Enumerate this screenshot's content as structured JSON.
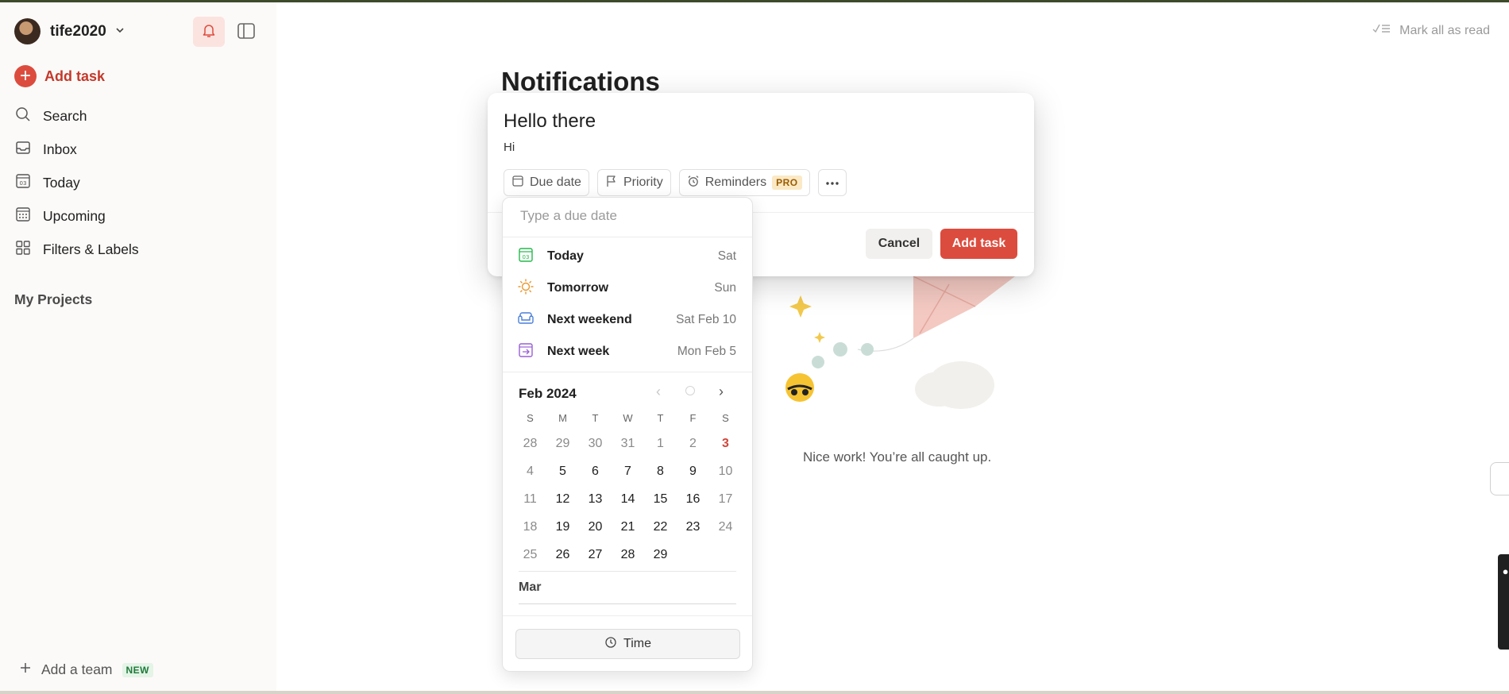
{
  "sidebar": {
    "username": "tife2020",
    "add_task": "Add task",
    "nav": [
      {
        "label": "Search",
        "icon": "search-icon"
      },
      {
        "label": "Inbox",
        "icon": "inbox-icon"
      },
      {
        "label": "Today",
        "icon": "calendar-today-icon"
      },
      {
        "label": "Upcoming",
        "icon": "calendar-grid-icon"
      },
      {
        "label": "Filters & Labels",
        "icon": "filters-icon"
      }
    ],
    "my_projects": "My Projects",
    "add_team": "Add a team",
    "new_badge": "NEW"
  },
  "main": {
    "mark_all_read": "Mark all as read",
    "title": "Notifications",
    "empty_message": "Nice work! You’re all caught up."
  },
  "task_modal": {
    "title": "Hello there",
    "description": "Hi",
    "chips": {
      "due_date": "Due date",
      "priority": "Priority",
      "reminders": "Reminders",
      "pro_badge": "PRO"
    },
    "cancel": "Cancel",
    "add_task": "Add task"
  },
  "due_date_picker": {
    "placeholder": "Type a due date",
    "suggestions": [
      {
        "label": "Today",
        "day": "Sat",
        "color": "#25b84c"
      },
      {
        "label": "Tomorrow",
        "day": "Sun",
        "color": "#e8972e"
      },
      {
        "label": "Next weekend",
        "day": "Sat Feb 10",
        "color": "#4a7fd9"
      },
      {
        "label": "Next week",
        "day": "Mon Feb 5",
        "color": "#9a5fd6"
      }
    ],
    "month_label": "Feb 2024",
    "weekdays": [
      "S",
      "M",
      "T",
      "W",
      "T",
      "F",
      "S"
    ],
    "days": [
      [
        "28",
        "29",
        "30",
        "31",
        "1",
        "2",
        "3"
      ],
      [
        "4",
        "5",
        "6",
        "7",
        "8",
        "9",
        "10"
      ],
      [
        "11",
        "12",
        "13",
        "14",
        "15",
        "16",
        "17"
      ],
      [
        "18",
        "19",
        "20",
        "21",
        "22",
        "23",
        "24"
      ],
      [
        "25",
        "26",
        "27",
        "28",
        "29",
        "",
        ""
      ]
    ],
    "next_month_label": "Mar",
    "time_button": "Time"
  },
  "colors": {
    "accent": "#dc4c3e",
    "sidebar_bg": "#fcfaf8"
  }
}
